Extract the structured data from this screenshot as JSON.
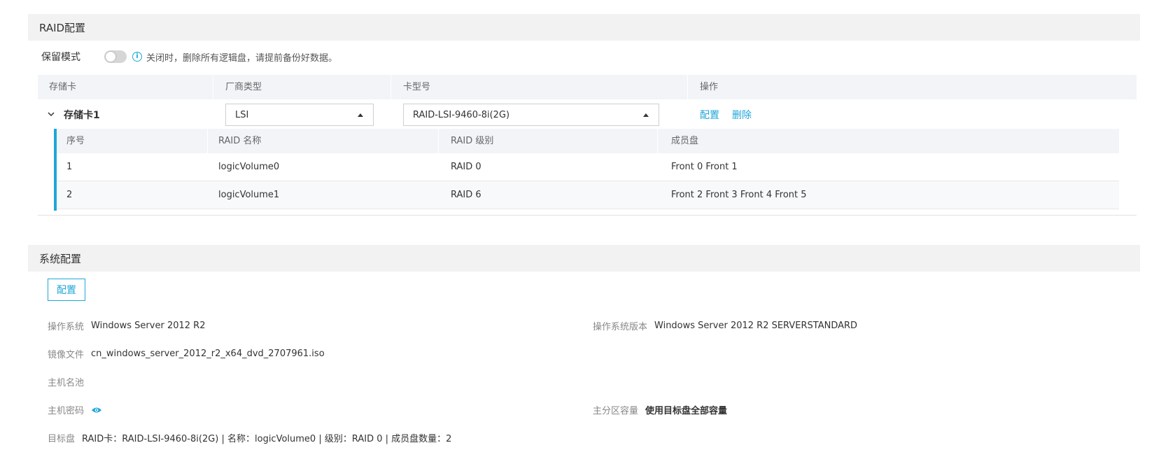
{
  "raid_section": {
    "title": "RAID配置",
    "keep_mode_label": "保留模式",
    "keep_mode_on": false,
    "hint": "关闭时，删除所有逻辑盘，请提前备份好数据。",
    "columns": [
      "存储卡",
      "厂商类型",
      "卡型号",
      "操作"
    ],
    "card": {
      "name": "存储卡1",
      "vendor": "LSI",
      "model": "RAID-LSI-9460-8i(2G)",
      "actions": {
        "configure": "配置",
        "delete": "删除"
      }
    },
    "inner_columns": [
      "序号",
      "RAID 名称",
      "RAID 级别",
      "成员盘"
    ],
    "rows": [
      {
        "index": "1",
        "name": "logicVolume0",
        "level": "RAID 0",
        "members": "Front 0 Front 1"
      },
      {
        "index": "2",
        "name": "logicVolume1",
        "level": "RAID 6",
        "members": "Front 2 Front 3 Front 4 Front 5"
      }
    ]
  },
  "system_section": {
    "title": "系统配置",
    "configure_button": "配置",
    "os_label": "操作系统",
    "os_value": "Windows Server 2012 R2",
    "os_version_label": "操作系统版本",
    "os_version_value": "Windows Server 2012 R2 SERVERSTANDARD",
    "image_label": "镜像文件",
    "image_value": "cn_windows_server_2012_r2_x64_dvd_2707961.iso",
    "hostname_pool_label": "主机名池",
    "host_password_label": "主机密码",
    "primary_partition_label": "主分区容量",
    "primary_partition_value": "使用目标盘全部容量",
    "target_disk_label": "目标盘",
    "target_disk_value": "RAID卡：RAID-LSI-9460-8i(2G) | 名称：logicVolume0 | 级别：RAID 0 | 成员盘数量：2"
  },
  "colors": {
    "accent": "#1fa6d9",
    "header_bg": "#f2f2f2",
    "table_head_bg": "#f2f4f7"
  }
}
